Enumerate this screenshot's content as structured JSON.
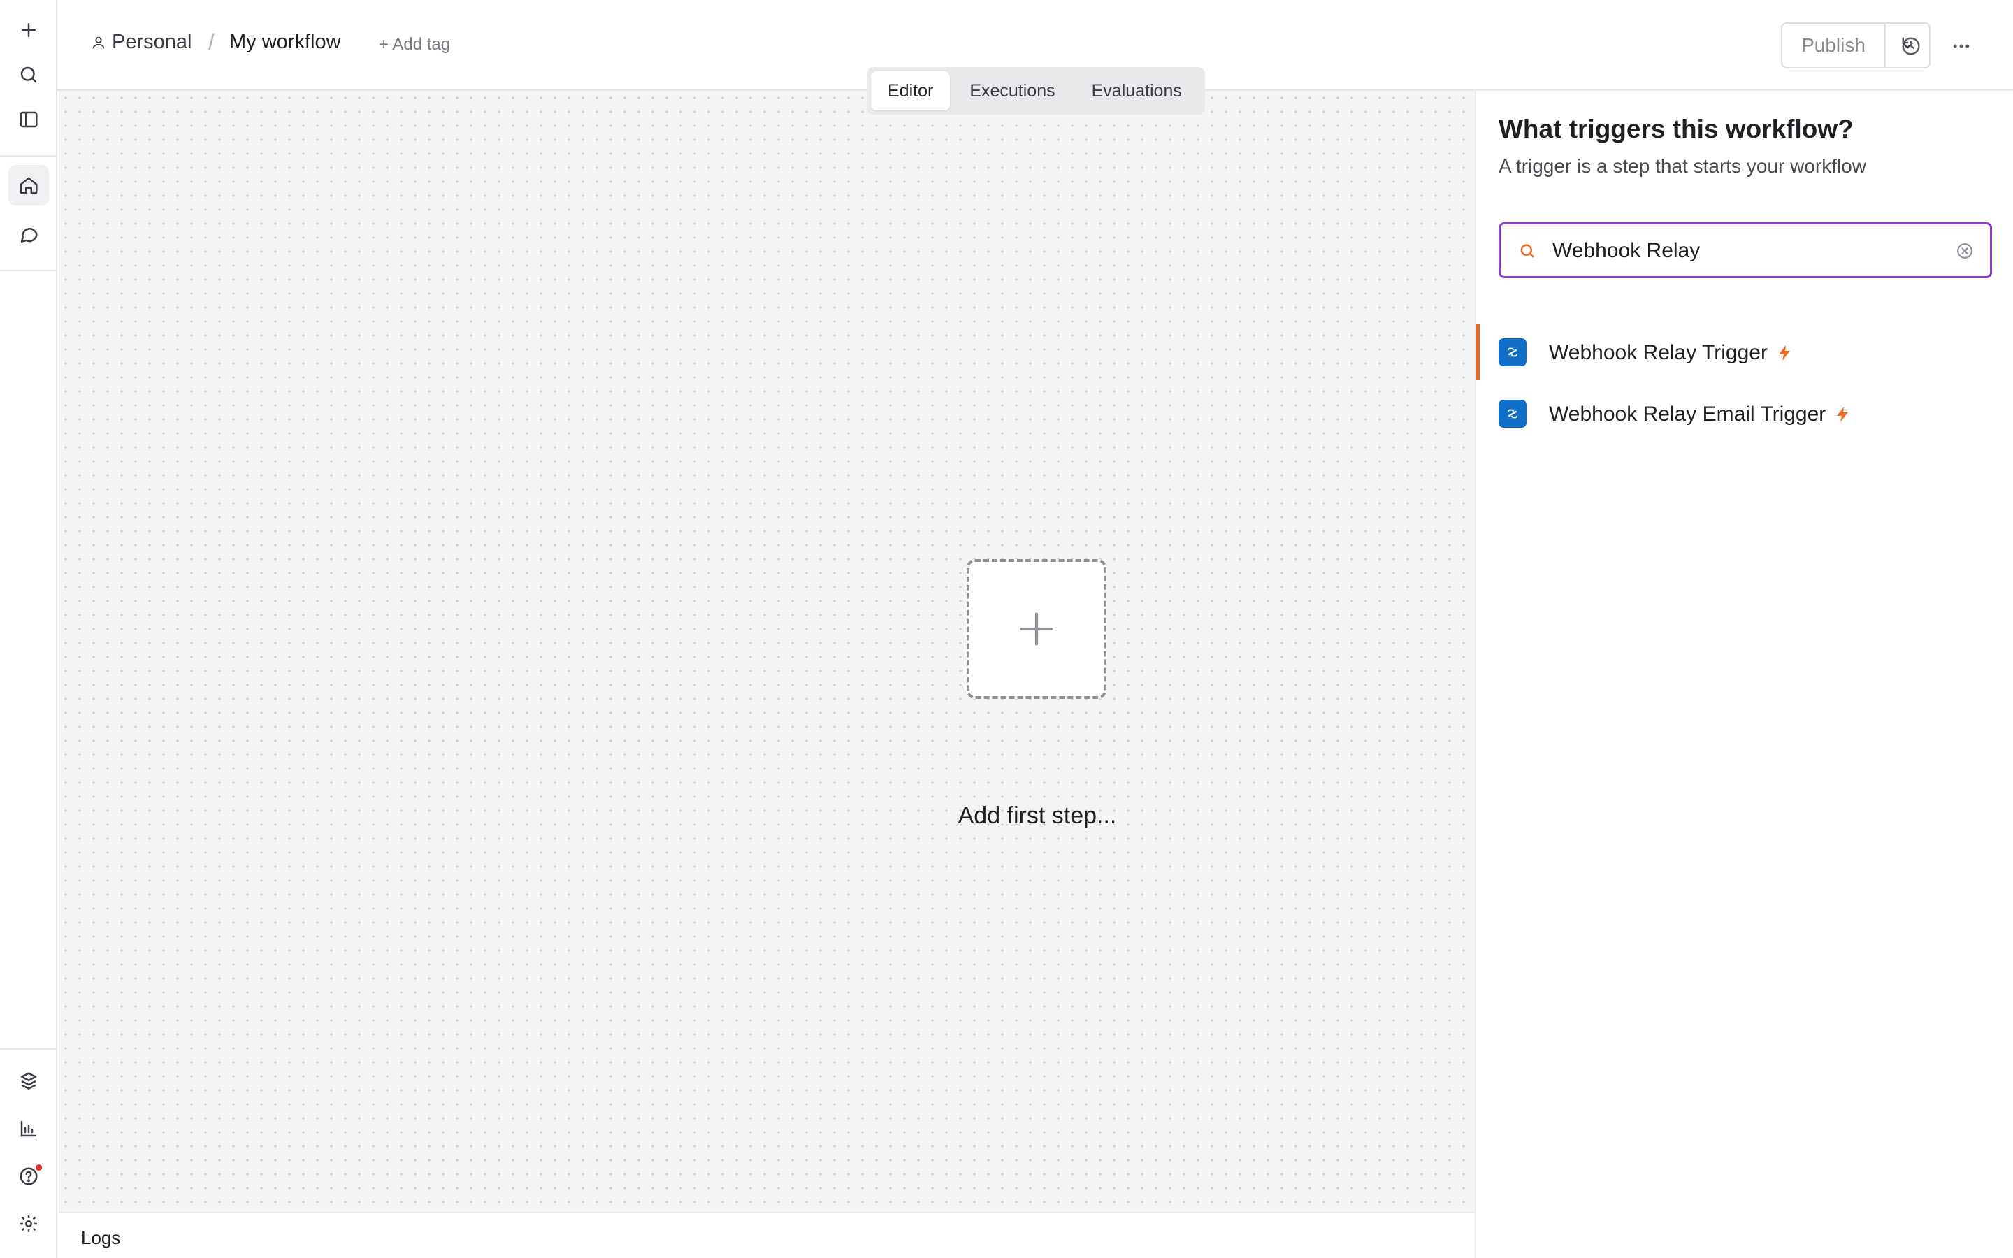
{
  "header": {
    "breadcrumb_project": "Personal",
    "breadcrumb_separator": "/",
    "workflow_name": "My workflow",
    "add_tag_label": "+ Add tag",
    "publish_label": "Publish"
  },
  "tabs": [
    {
      "label": "Editor",
      "active": true
    },
    {
      "label": "Executions",
      "active": false
    },
    {
      "label": "Evaluations",
      "active": false
    }
  ],
  "canvas": {
    "add_first_step_label": "Add first step..."
  },
  "logs": {
    "label": "Logs"
  },
  "trigger_panel": {
    "title": "What triggers this workflow?",
    "subtitle": "A trigger is a step that starts your workflow",
    "search_value": "Webhook Relay",
    "results": [
      {
        "label": "Webhook Relay Trigger",
        "selected": true
      },
      {
        "label": "Webhook Relay Email Trigger",
        "selected": false
      }
    ]
  },
  "icons": {
    "rail_top": [
      "plus-icon",
      "search-icon",
      "sidebar-toggle-icon",
      "home-icon",
      "chat-icon"
    ],
    "rail_bottom": [
      "templates-icon",
      "insights-icon",
      "help-icon",
      "settings-icon"
    ],
    "canvas_controls": [
      "fit-view-icon",
      "zoom-in-icon",
      "zoom-out-icon",
      "tidy-up-icon"
    ]
  },
  "colors": {
    "accent_orange": "#f06a27",
    "search_focus_border": "#8a3fd1",
    "node_icon_blue": "#0f6fc6",
    "notification_dot": "#e0322c"
  }
}
